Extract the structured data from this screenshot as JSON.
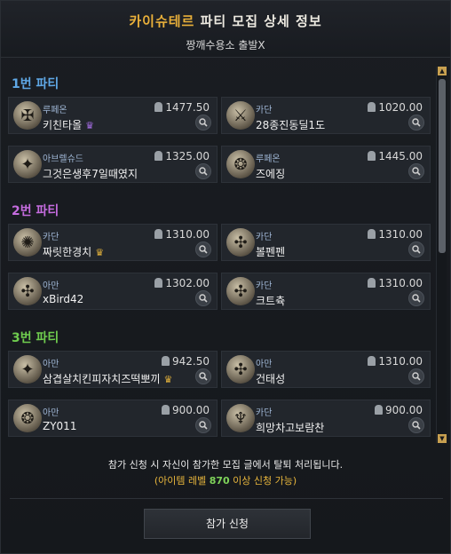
{
  "header": {
    "title_accent": "카이슈테르",
    "title_rest": " 파티 모집 상세 정보",
    "subtitle": "짱깨수용소 출발X"
  },
  "parties": [
    {
      "label": "1번 파티",
      "members": [
        {
          "class": "루페온",
          "name": "키친타올",
          "ilvl": "1477.50",
          "crown": "purple",
          "avatar": "paladin-icon"
        },
        {
          "class": "카단",
          "name": "28종진동딜1도",
          "ilvl": "1020.00",
          "crown": "",
          "avatar": "slayer-icon"
        },
        {
          "class": "아브렐슈드",
          "name": "그것은생후7일때였지",
          "ilvl": "1325.00",
          "crown": "",
          "avatar": "sorceress-icon"
        },
        {
          "class": "루페온",
          "name": "즈에징",
          "ilvl": "1445.00",
          "crown": "",
          "avatar": "artist-icon"
        }
      ]
    },
    {
      "label": "2번 파티",
      "members": [
        {
          "class": "카단",
          "name": "짜릿한경치",
          "ilvl": "1310.00",
          "crown": "gold",
          "avatar": "aeromancer-icon"
        },
        {
          "class": "카단",
          "name": "볼펜펜",
          "ilvl": "1310.00",
          "crown": "",
          "avatar": "gunslinger-icon"
        },
        {
          "class": "아만",
          "name": "xBird42",
          "ilvl": "1302.00",
          "crown": "",
          "avatar": "gunslinger-icon"
        },
        {
          "class": "카단",
          "name": "크트츅",
          "ilvl": "1310.00",
          "crown": "",
          "avatar": "gunslinger-icon"
        }
      ]
    },
    {
      "label": "3번 파티",
      "members": [
        {
          "class": "아만",
          "name": "삼겹살치킨피자치즈떡뽀끼",
          "ilvl": "942.50",
          "crown": "gold",
          "avatar": "sorceress-icon"
        },
        {
          "class": "아만",
          "name": "건태성",
          "ilvl": "1310.00",
          "crown": "",
          "avatar": "gunslinger-icon"
        },
        {
          "class": "아만",
          "name": "ZY011",
          "ilvl": "900.00",
          "crown": "",
          "avatar": "artist-icon"
        },
        {
          "class": "카단",
          "name": "희망차고보람찬",
          "ilvl": "900.00",
          "crown": "",
          "avatar": "demonic-icon"
        }
      ]
    }
  ],
  "footer": {
    "notice": "참가 신청 시 자신이 참가한 모집 글에서 탈퇴 처리됩니다.",
    "req_open": "(아이템 레벨 ",
    "req_value": "870",
    "req_close": " 이상 신청 가능)",
    "apply_label": "참가 신청"
  },
  "colors": {
    "title_accent": "#e9b03a",
    "party1": "#5fa8e6",
    "party2": "#c56cdf",
    "party3": "#6fcc4e"
  }
}
